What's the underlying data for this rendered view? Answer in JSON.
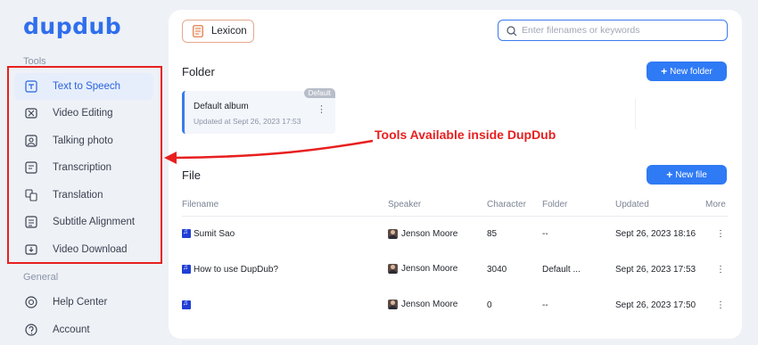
{
  "app": {
    "logo_text": "dupdub",
    "brand_color": "#2f6fed"
  },
  "sidebar": {
    "tools_label": "Tools",
    "general_label": "General",
    "tools": [
      {
        "label": "Text to Speech",
        "icon": "text-to-speech-icon",
        "active": true
      },
      {
        "label": "Video Editing",
        "icon": "video-editing-icon",
        "active": false
      },
      {
        "label": "Talking photo",
        "icon": "talking-photo-icon",
        "active": false
      },
      {
        "label": "Transcription",
        "icon": "transcription-icon",
        "active": false
      },
      {
        "label": "Translation",
        "icon": "translation-icon",
        "active": false
      },
      {
        "label": "Subtitle Alignment",
        "icon": "subtitle-alignment-icon",
        "active": false
      },
      {
        "label": "Video Download",
        "icon": "video-download-icon",
        "active": false
      }
    ],
    "general": [
      {
        "label": "Help Center",
        "icon": "help-center-icon"
      },
      {
        "label": "Account",
        "icon": "account-icon"
      }
    ]
  },
  "header": {
    "lexicon_label": "Lexicon",
    "search_placeholder": "Enter filenames or keywords"
  },
  "folder_section": {
    "title": "Folder",
    "new_button": "New folder",
    "albums": [
      {
        "name": "Default album",
        "updated": "Updated at Sept 26, 2023 17:53",
        "tag": "Default"
      }
    ]
  },
  "file_section": {
    "title": "File",
    "new_button": "New file",
    "columns": [
      "Filename",
      "Speaker",
      "Character",
      "Folder",
      "Updated",
      "More"
    ],
    "rows": [
      {
        "filename": "Sumit Sao",
        "speaker": "Jenson Moore",
        "character": "85",
        "folder": "--",
        "updated": "Sept 26, 2023 18:16"
      },
      {
        "filename": "How to use DupDub?",
        "speaker": "Jenson Moore",
        "character": "3040",
        "folder": "Default ...",
        "updated": "Sept 26, 2023 17:53"
      },
      {
        "filename": "",
        "speaker": "Jenson Moore",
        "character": "0",
        "folder": "--",
        "updated": "Sept 26, 2023 17:50"
      }
    ]
  },
  "annotation": {
    "text": "Tools Available inside DupDub",
    "color": "#e81f1f"
  }
}
